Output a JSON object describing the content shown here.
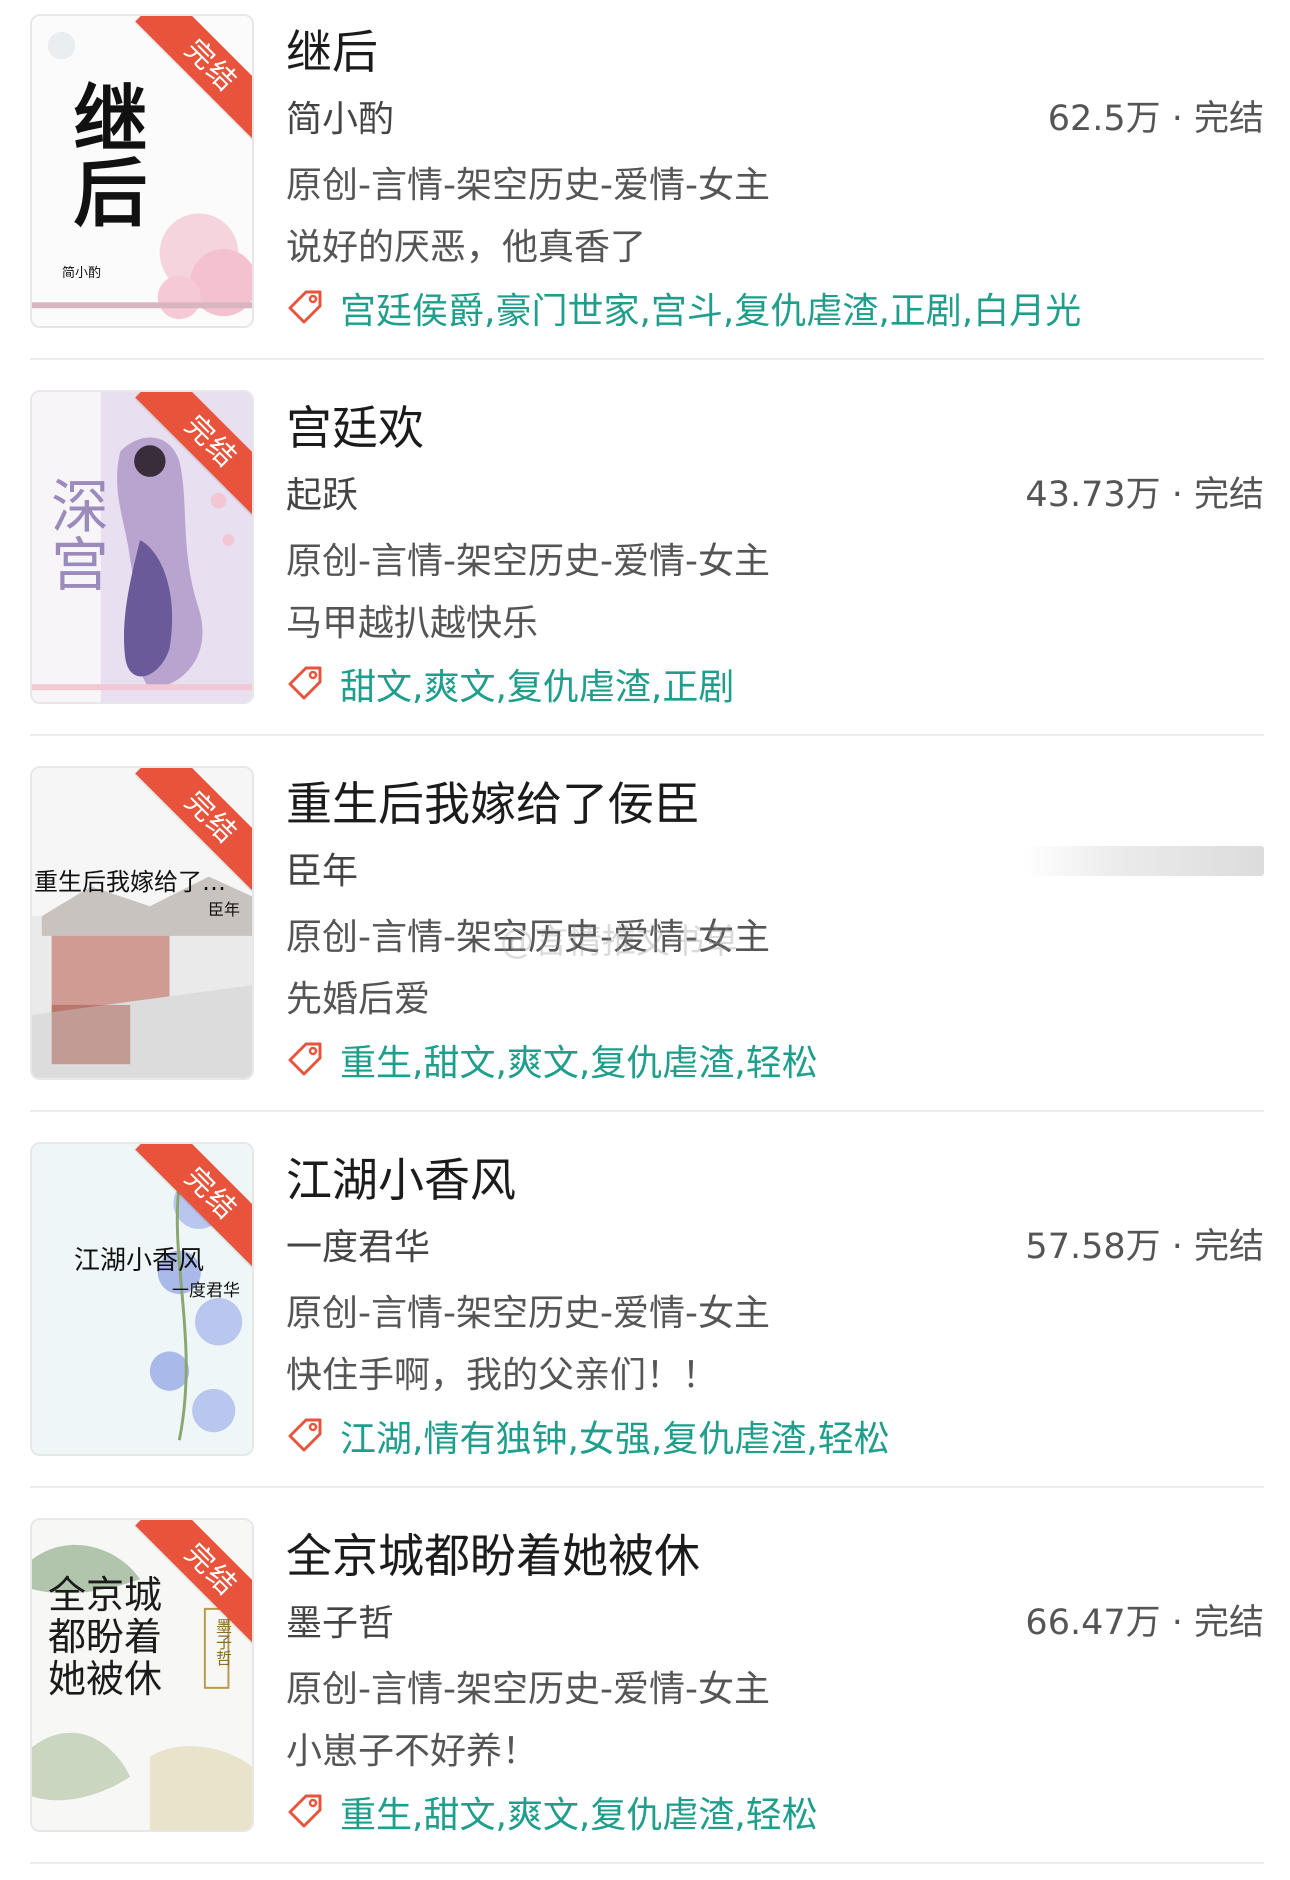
{
  "books": [
    {
      "title": "继后",
      "author": "简小酌",
      "stats": "62.5万 · 完结",
      "category": "原创-言情-架空历史-爱情-女主",
      "description": "说好的厌恶，他真香了",
      "tags": "宫廷侯爵,豪门世家,宫斗,复仇虐渣,正剧,白月光",
      "badge": "完结",
      "cover_title": "继后",
      "cover_author": "简小酌"
    },
    {
      "title": "宫廷欢",
      "author": "起跃",
      "stats": "43.73万 · 完结",
      "category": "原创-言情-架空历史-爱情-女主",
      "description": "马甲越扒越快乐",
      "tags": "甜文,爽文,复仇虐渣,正剧",
      "badge": "完结",
      "cover_title": "深宫"
    },
    {
      "title": "重生后我嫁给了佞臣",
      "author": "臣年",
      "stats": "",
      "category": "原创-言情-架空历史-爱情-女主",
      "description": "先婚后爱",
      "tags": "重生,甜文,爽文,复仇虐渣,轻松",
      "badge": "完结",
      "cover_title": "重生后我嫁给了…",
      "cover_author": "臣年"
    },
    {
      "title": "江湖小香风",
      "author": "一度君华",
      "stats": "57.58万 · 完结",
      "category": "原创-言情-架空历史-爱情-女主",
      "description": "快住手啊，我的父亲们！！",
      "tags": "江湖,情有独钟,女强,复仇虐渣,轻松",
      "badge": "完结",
      "cover_title": "江湖小香风",
      "cover_author": "一度君华"
    },
    {
      "title": "全京城都盼着她被休",
      "author": "墨子哲",
      "stats": "66.47万 · 完结",
      "category": "原创-言情-架空历史-爱情-女主",
      "description": "小崽子不好养！",
      "tags": "重生,甜文,爽文,复仇虐渣,轻松",
      "badge": "完结",
      "cover_title": "全京城都盼着她被休",
      "cover_author": "墨子哲"
    }
  ],
  "watermark": "@言情推文书单",
  "colors": {
    "tag_text": "#1f9e8c",
    "badge_bg": "#e8533b",
    "tag_icon": "#e8533b"
  },
  "icons": {
    "tag": "tag-icon"
  }
}
